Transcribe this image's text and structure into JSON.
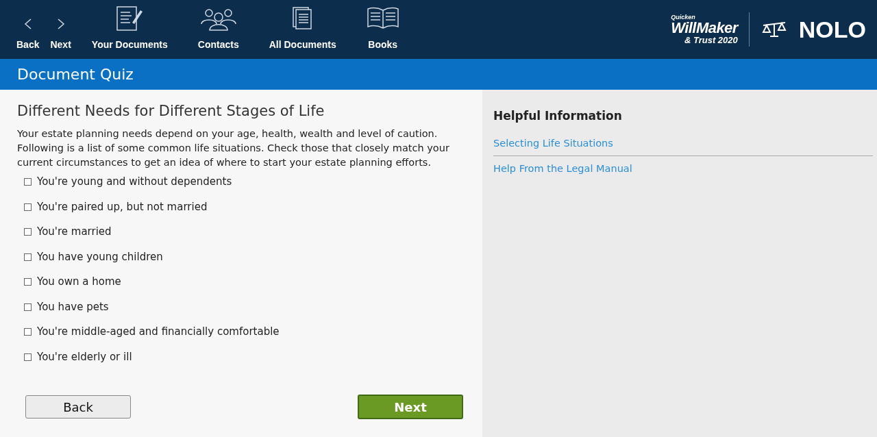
{
  "toolbar": [
    {
      "kind": "back",
      "label": "Back"
    },
    {
      "kind": "next",
      "label": "Next"
    },
    {
      "kind": "document",
      "label": "Your Documents"
    },
    {
      "kind": "contacts",
      "label": "Contacts"
    },
    {
      "kind": "documents",
      "label": "All Documents"
    },
    {
      "kind": "book",
      "label": "Books"
    }
  ],
  "logo": {
    "brand": "Quicken",
    "product": "WillMaker",
    "edition": "& Trust 2020",
    "publisher": "NOLO"
  },
  "header": {
    "title": "Document Quiz"
  },
  "quiz": {
    "heading": "Different Needs for Different Stages of Life",
    "intro": "Your estate planning needs depend on your age, health, wealth and level of caution. Following is a list of some common life situations. Check those that closely match your current circumstances to get an idea of where to start your estate planning efforts.",
    "options": [
      {
        "label": "You're young and without dependents",
        "checked": false
      },
      {
        "label": "You're paired up, but not married",
        "checked": false
      },
      {
        "label": "You're married",
        "checked": false
      },
      {
        "label": "You have young children",
        "checked": false
      },
      {
        "label": "You own a home",
        "checked": false
      },
      {
        "label": "You have pets",
        "checked": false
      },
      {
        "label": "You're middle-aged and financially comfortable",
        "checked": false
      },
      {
        "label": "You're elderly or ill",
        "checked": false
      }
    ],
    "back_button": "Back",
    "next_button": "Next"
  },
  "help": {
    "title": "Helpful Information",
    "links": [
      "Selecting Life Situations",
      "Help From the Legal Manual"
    ]
  }
}
